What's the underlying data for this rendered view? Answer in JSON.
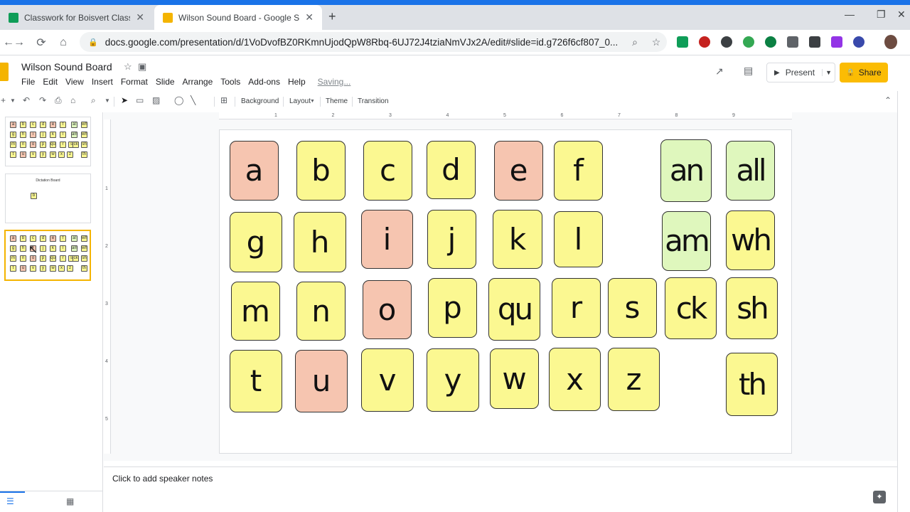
{
  "browser": {
    "tabs": [
      {
        "title": "Classwork for Boisvert Classroom",
        "color": "#0f9d58"
      },
      {
        "title": "Wilson Sound Board - Google Sli",
        "color": "#f4b400"
      }
    ],
    "new_tab": "+",
    "url": "docs.google.com/presentation/d/1VoDvofBZ0RKmnUjodQpW8Rbq-6UJ72J4tziaNmVJx2A/edit#slide=id.g726f6cf807_0..."
  },
  "app": {
    "title": "Wilson Sound Board",
    "menu": [
      "File",
      "Edit",
      "View",
      "Insert",
      "Format",
      "Slide",
      "Arrange",
      "Tools",
      "Add-ons",
      "Help"
    ],
    "status": "Saving...",
    "present_label": "Present",
    "share_label": "Share"
  },
  "toolbar": {
    "background_label": "Background",
    "layout_label": "Layout",
    "theme_label": "Theme",
    "transition_label": "Transition"
  },
  "filmstrip": {
    "slide2_title": "Dictation Board",
    "slide2_letter": "b",
    "thumb_letters": [
      "a",
      "b",
      "c",
      "d",
      "e",
      "f",
      "al",
      "wh",
      "g",
      "h",
      "i",
      "j",
      "k",
      "l",
      "am",
      "wh",
      "m",
      "n",
      "o",
      "p",
      "qu",
      "r",
      "s",
      "ck",
      "sh",
      "t",
      "u",
      "v",
      "y",
      "w",
      "x",
      "z",
      "th"
    ]
  },
  "ruler": {
    "h": [
      "1",
      "2",
      "3",
      "4",
      "5",
      "6",
      "7",
      "8",
      "9"
    ],
    "v": [
      "1",
      "2",
      "3",
      "4",
      "5"
    ]
  },
  "colors": {
    "vowel": "#f6c5b0",
    "consonant": "#fbf891",
    "welded": "#dff7bd"
  },
  "cards": [
    {
      "text": "a",
      "kind": "vowel"
    },
    {
      "text": "b",
      "kind": "consonant"
    },
    {
      "text": "c",
      "kind": "consonant"
    },
    {
      "text": "d",
      "kind": "consonant"
    },
    {
      "text": "e",
      "kind": "vowel"
    },
    {
      "text": "f",
      "kind": "consonant"
    },
    {
      "text": "an",
      "kind": "welded"
    },
    {
      "text": "all",
      "kind": "welded"
    },
    {
      "text": "g",
      "kind": "consonant"
    },
    {
      "text": "h",
      "kind": "consonant"
    },
    {
      "text": "i",
      "kind": "vowel"
    },
    {
      "text": "j",
      "kind": "consonant"
    },
    {
      "text": "k",
      "kind": "consonant"
    },
    {
      "text": "l",
      "kind": "consonant"
    },
    {
      "text": "am",
      "kind": "welded"
    },
    {
      "text": "wh",
      "kind": "consonant"
    },
    {
      "text": "m",
      "kind": "consonant"
    },
    {
      "text": "n",
      "kind": "consonant"
    },
    {
      "text": "o",
      "kind": "vowel"
    },
    {
      "text": "p",
      "kind": "consonant"
    },
    {
      "text": "qu",
      "kind": "consonant"
    },
    {
      "text": "r",
      "kind": "consonant"
    },
    {
      "text": "s",
      "kind": "consonant"
    },
    {
      "text": "ck",
      "kind": "consonant"
    },
    {
      "text": "sh",
      "kind": "consonant"
    },
    {
      "text": "t",
      "kind": "consonant"
    },
    {
      "text": "u",
      "kind": "vowel"
    },
    {
      "text": "v",
      "kind": "consonant"
    },
    {
      "text": "y",
      "kind": "consonant"
    },
    {
      "text": "w",
      "kind": "consonant"
    },
    {
      "text": "x",
      "kind": "consonant"
    },
    {
      "text": "z",
      "kind": "consonant"
    },
    {
      "text": "th",
      "kind": "consonant"
    }
  ],
  "notes_placeholder": "Click to add speaker notes"
}
